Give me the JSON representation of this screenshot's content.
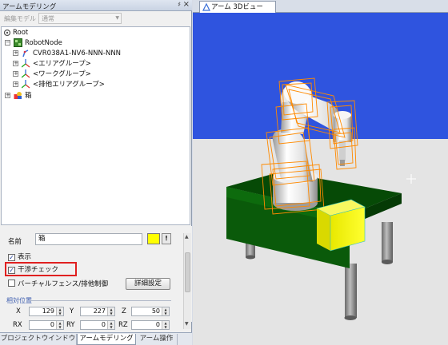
{
  "panel": {
    "title": "アームモデリング",
    "pin": "♯",
    "close": "×"
  },
  "model": {
    "label": "編集モデル",
    "value": "通常"
  },
  "tree": {
    "root": "Root",
    "robot_node": "RobotNode",
    "robot_model": "CVR038A1-NV6-NNN-NNN",
    "area_group": "<エリアグループ>",
    "work_group": "<ワークグループ>",
    "exclusion_group": "<排他エリアグループ>",
    "box": "箱"
  },
  "props": {
    "name_label": "名前",
    "name_value": "箱",
    "color": "#ffff00",
    "excl_button": "!",
    "display_label": "表示",
    "display_checked": true,
    "interference_label": "干渉チェック",
    "interference_checked": true,
    "virtual_fence_label": "バーチャルフェンス/排他制御",
    "virtual_fence_checked": false,
    "detail_button": "詳細設定",
    "section_relative": "相対位置",
    "x_label": "X",
    "x_value": "129",
    "y_label": "Y",
    "y_value": "227",
    "z_label": "Z",
    "z_value": "50",
    "rx_label": "RX",
    "rx_value": "0",
    "ry_label": "RY",
    "ry_value": "0",
    "rz_label": "RZ",
    "rz_value": "0"
  },
  "bottom_tabs": [
    "プロジェクトウインドウ",
    "アームモデリング",
    "アーム操作"
  ],
  "viewport": {
    "tab": "アーム 3Dビュー",
    "sky_color": "#2f54df",
    "floor_color": "#e4e4e4",
    "table_color": "#064a06",
    "box_color": "#f2f200",
    "wireframe_color": "#ff8a00"
  }
}
